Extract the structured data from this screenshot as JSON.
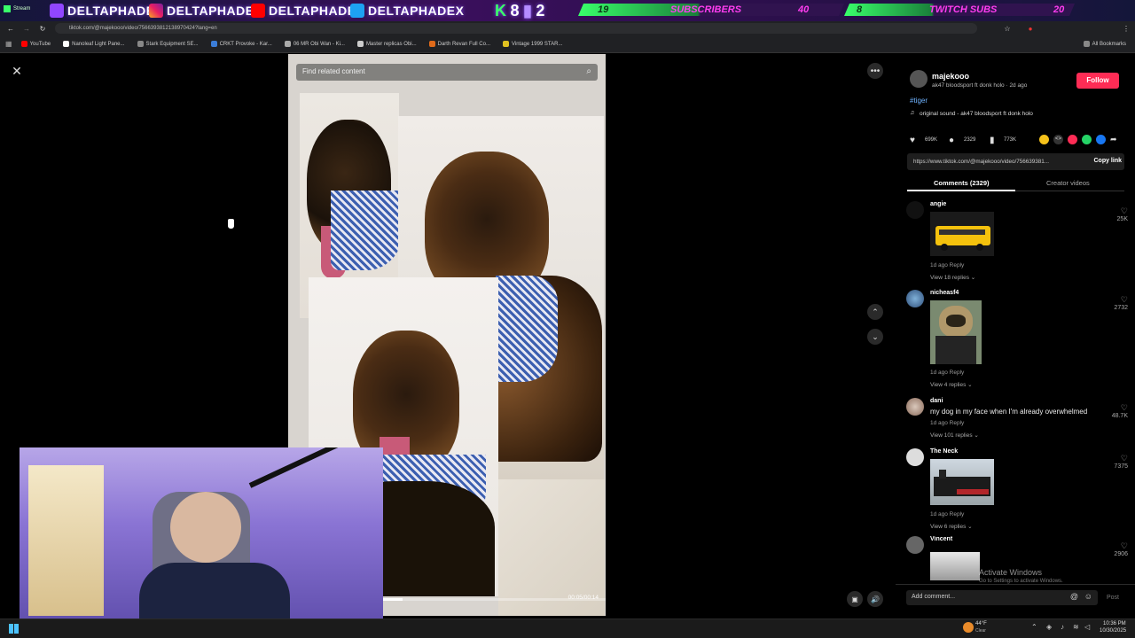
{
  "overlay": {
    "handles": [
      "DELTAPHADE",
      "DELTAPHADE",
      "DELTAPHADE",
      "DELTAPHADEX"
    ],
    "kick_count": "8",
    "twitch_count": "2",
    "subscribers_label": "SUBSCRIBERS",
    "subscribers_now": "19",
    "subscribers_goal": "40",
    "twitch_subs_label": "TWITCH SUBS",
    "twitch_subs_now": "8",
    "twitch_subs_goal": "20"
  },
  "browser": {
    "url": "tiktok.com/@majekooo/video/7566393812138970424?lang=en",
    "tab_title": "Stream",
    "bookmarks": [
      {
        "label": "YouTube",
        "color": "#ff0000"
      },
      {
        "label": "Nanoleaf Light Pane...",
        "color": "#ffffff"
      },
      {
        "label": "Stark Equipment SE...",
        "color": "#888888"
      },
      {
        "label": "CRKT Provoke - Kar...",
        "color": "#3b7dd8"
      },
      {
        "label": "06 MR Obi Wan - Ki...",
        "color": "#aaaaaa"
      },
      {
        "label": "Master replicas Obi...",
        "color": "#cccccc"
      },
      {
        "label": "Darth Revan Full Co...",
        "color": "#e06a1a"
      },
      {
        "label": "Vintage 1999 STAR...",
        "color": "#e0c020"
      }
    ],
    "all_bookmarks": "All Bookmarks"
  },
  "video": {
    "search_placeholder": "Find related content",
    "time": "00:05/00:14",
    "progress": 0.36
  },
  "post": {
    "author": "majekooo",
    "subtitle": "ak47 bloodsport ft donk holo · 2d ago",
    "follow_label": "Follow",
    "hashtag": "#tiger",
    "sound": "original sound - ak47 bloodsport ft donk holo",
    "likes": "699K",
    "comments": "2329",
    "saves": "773K",
    "link": "https://www.tiktok.com/@majekooo/video/756639381...",
    "copy_link": "Copy link",
    "tab_comments": "Comments (2329)",
    "tab_creator": "Creator videos"
  },
  "comments": [
    {
      "name": "angie",
      "text": "",
      "meta": "1d ago    Reply",
      "view": "View 18 replies",
      "likes": "25K",
      "image": "school-bus"
    },
    {
      "name": "nicheasf4",
      "text": "",
      "meta": "1d ago    Reply",
      "view": "View 4 replies",
      "likes": "2732",
      "image": "pug"
    },
    {
      "name": "dani",
      "text": "my dog in my face when I'm already overwhelmed",
      "meta": "1d ago    Reply",
      "view": "View 101 replies",
      "likes": "48.7K",
      "image": ""
    },
    {
      "name": "The Neck",
      "text": "",
      "meta": "1d ago    Reply",
      "view": "View 6 replies",
      "likes": "7375",
      "image": "train"
    },
    {
      "name": "Vincent",
      "text": "",
      "meta": "",
      "view": "",
      "likes": "2906",
      "image": "engine"
    }
  ],
  "comment_input": {
    "placeholder": "Add comment...",
    "post_label": "Post"
  },
  "watermark": {
    "line1": "Activate Windows",
    "line2": "Go to Settings to activate Windows."
  },
  "taskbar": {
    "weather": "44°F",
    "weather_sub": "Clear",
    "time": "10:36 PM",
    "date": "10/30/2025"
  },
  "colors": {
    "follow": "#fe2c55",
    "hashtag": "#6fb3ff",
    "overlay_green": "#39ff6a",
    "overlay_pink": "#ff3df0"
  }
}
